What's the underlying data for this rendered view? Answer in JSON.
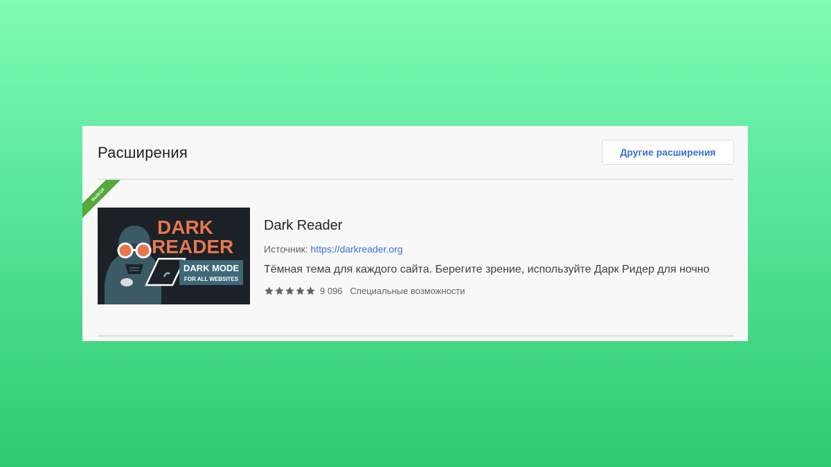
{
  "header": {
    "title": "Расширения",
    "more_button": "Другие расширения"
  },
  "extension": {
    "ribbon": "ВЫБОР",
    "name": "Dark Reader",
    "source_label": "Источник:",
    "source_link": "https://darkreader.org",
    "description": "Тёмная тема для каждого сайта. Берегите зрение, используйте Дарк Ридер для ночно",
    "rating_stars": 5,
    "rating_count": "9 096",
    "category": "Специальные возможности",
    "thumbnail": {
      "line1": "DARK",
      "line2": "READER",
      "badge_line1": "DARK MODE",
      "badge_line2": "FOR ALL WEBSITES"
    }
  },
  "colors": {
    "accent": "#3b6fd4",
    "ribbon": "#56a839",
    "thumb_bg": "#1c2127",
    "thumb_title": "#e6784c",
    "thumb_badge": "#3d6878"
  }
}
